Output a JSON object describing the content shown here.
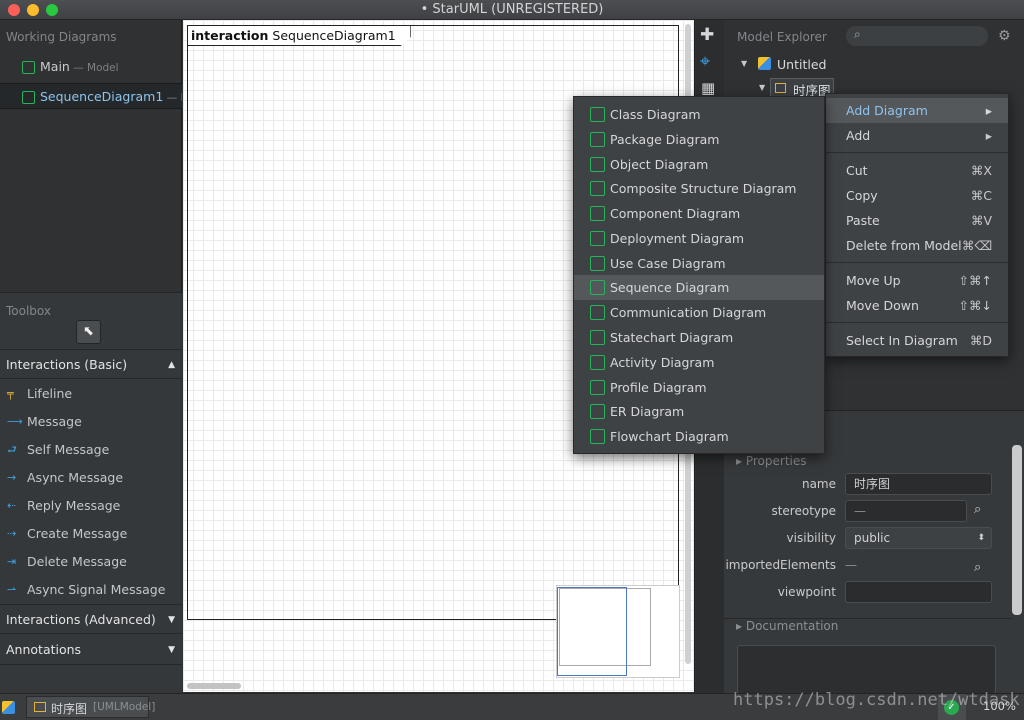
{
  "window": {
    "title": "• StarUML (UNREGISTERED)"
  },
  "working_diagrams": {
    "title": "Working Diagrams",
    "items": [
      {
        "name": "Main",
        "sub": " — Model"
      },
      {
        "name": "SequenceDiagram1",
        "sub": " — Inter"
      }
    ]
  },
  "toolbox": {
    "title": "Toolbox",
    "groups": {
      "basic": "Interactions (Basic)",
      "advanced": "Interactions (Advanced)",
      "annotations": "Annotations"
    },
    "tools": [
      "Lifeline",
      "Message",
      "Self Message",
      "Async Message",
      "Reply Message",
      "Create Message",
      "Delete Message",
      "Async Signal Message"
    ]
  },
  "canvas": {
    "frame_keyword": "interaction",
    "frame_name": "SequenceDiagram1"
  },
  "explorer": {
    "title": "Model Explorer",
    "root": "Untitled",
    "child": "时序图"
  },
  "context_menu": {
    "items": [
      {
        "label": "Add Diagram",
        "shortcut": "▸"
      },
      {
        "label": "Add",
        "shortcut": "▸"
      },
      {
        "label": "Cut",
        "shortcut": "⌘X"
      },
      {
        "label": "Copy",
        "shortcut": "⌘C"
      },
      {
        "label": "Paste",
        "shortcut": "⌘V"
      },
      {
        "label": "Delete from Model",
        "shortcut": "⌘⌫"
      },
      {
        "label": "Move Up",
        "shortcut": "⇧⌘↑"
      },
      {
        "label": "Move Down",
        "shortcut": "⇧⌘↓"
      },
      {
        "label": "Select In Diagram",
        "shortcut": "⌘D"
      }
    ]
  },
  "submenu": {
    "items": [
      "Class Diagram",
      "Package Diagram",
      "Object Diagram",
      "Composite Structure Diagram",
      "Component Diagram",
      "Deployment Diagram",
      "Use Case Diagram",
      "Sequence Diagram",
      "Communication Diagram",
      "Statechart Diagram",
      "Activity Diagram",
      "Profile Diagram",
      "ER Diagram",
      "Flowchart Diagram"
    ]
  },
  "properties": {
    "title": "Properties",
    "labels": {
      "name": "name",
      "stereotype": "stereotype",
      "visibility": "visibility",
      "importedElements": "importedElements",
      "viewpoint": "viewpoint"
    },
    "values": {
      "name": "时序图",
      "stereotype": "—",
      "visibility": "public",
      "importedElements": "—",
      "viewpoint": ""
    },
    "documentation": "Documentation"
  },
  "statusbar": {
    "element_name": "时序图",
    "element_type": "[UMLModel]",
    "zoom": "100%"
  },
  "watermark": "https://blog.csdn.net/wtdask",
  "colors": {
    "accent_green": "#26b35a",
    "menu_highlight": "#55585b",
    "select_blue": "#4a78c4"
  }
}
